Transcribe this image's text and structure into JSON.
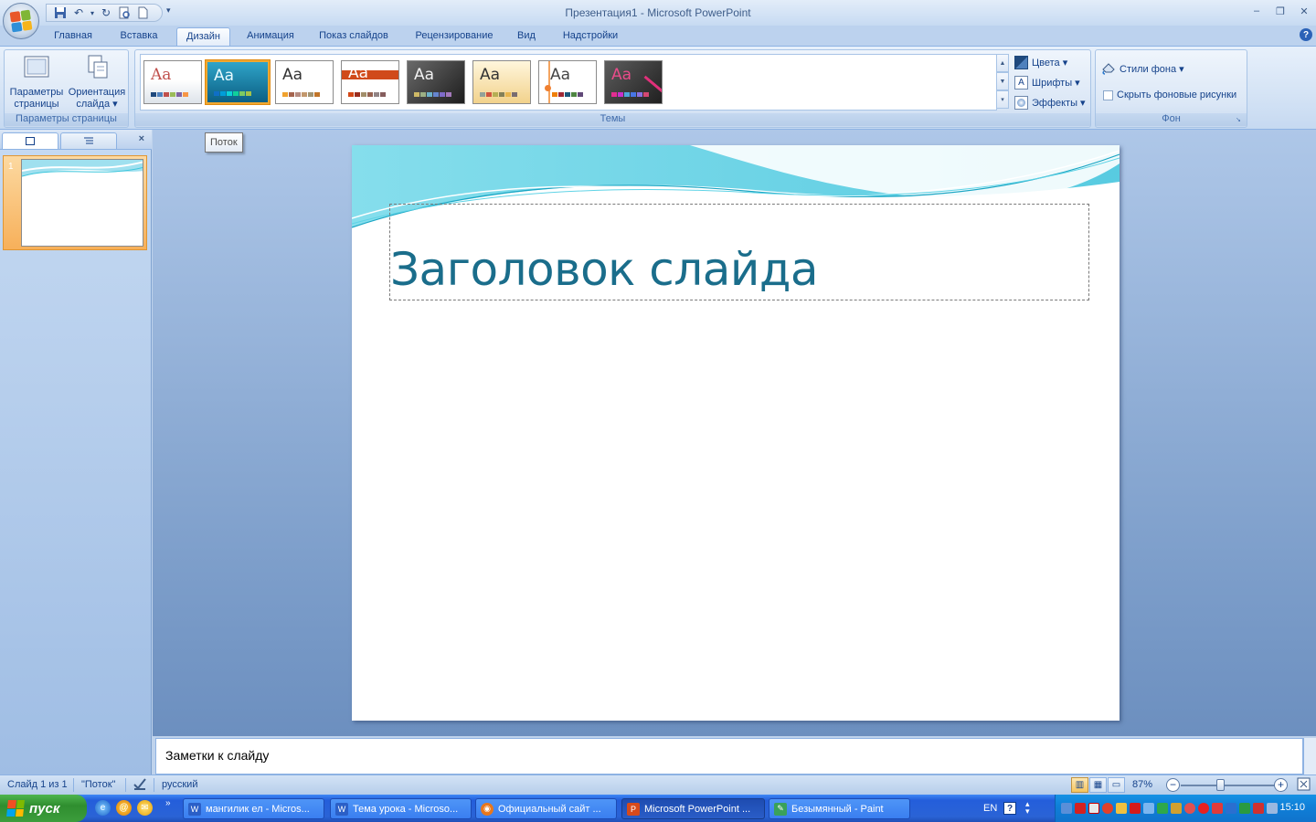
{
  "window": {
    "title": "Презентация1 - Microsoft PowerPoint",
    "controls": {
      "minimize": "‒",
      "restore": "❐",
      "close": "✕"
    }
  },
  "quick_access": {
    "more": "▾"
  },
  "tabs": [
    {
      "label": "Главная"
    },
    {
      "label": "Вставка"
    },
    {
      "label": "Дизайн"
    },
    {
      "label": "Анимация"
    },
    {
      "label": "Показ слайдов"
    },
    {
      "label": "Рецензирование"
    },
    {
      "label": "Вид"
    },
    {
      "label": "Надстройки"
    }
  ],
  "active_tab": "Дизайн",
  "ribbon": {
    "page_setup": {
      "label": "Параметры страницы",
      "page_params_l1": "Параметры",
      "page_params_l2": "страницы",
      "orientation_l1": "Ориентация",
      "orientation_l2": "слайда ▾"
    },
    "themes": {
      "label": "Темы",
      "aa": "Aa",
      "colors": "Цвета ▾",
      "fonts": "Шрифты ▾",
      "effects": "Эффекты ▾",
      "fonts_icon_glyph": "A"
    },
    "background": {
      "label": "Фон",
      "styles": "Стили фона ▾",
      "hide_graphics": "Скрыть фоновые рисунки"
    }
  },
  "tooltip": "Поток",
  "slides_panel": {
    "close": "×",
    "slide_number": "1"
  },
  "slide": {
    "title": "Заголовок слайда"
  },
  "notes": {
    "placeholder": "Заметки к слайду"
  },
  "status": {
    "slide": "Слайд 1 из 1",
    "theme": "\"Поток\"",
    "language": "русский",
    "zoom": "87%",
    "zoom_minus": "−",
    "zoom_plus": "+"
  },
  "taskbar": {
    "start": "пуск",
    "quicklaunch_more": "»",
    "tasks": [
      {
        "label": "мангилик ел - Micros...",
        "icon_color": "#2b5fc7"
      },
      {
        "label": "Тема урока - Microso...",
        "icon_color": "#2b5fc7"
      },
      {
        "label": "Официальный сайт ...",
        "icon_color": "#e8771c"
      },
      {
        "label": "Microsoft PowerPoint ...",
        "icon_color": "#d64a1c"
      },
      {
        "label": "Безымянный - Paint",
        "icon_color": "#3aa15a"
      }
    ],
    "lang": "EN",
    "lang_help": "?",
    "clock": "15:10"
  },
  "colors": {
    "accent_orange": "#f0a830",
    "title_teal": "#1a6d8b",
    "ribbon_text": "#15428b"
  }
}
